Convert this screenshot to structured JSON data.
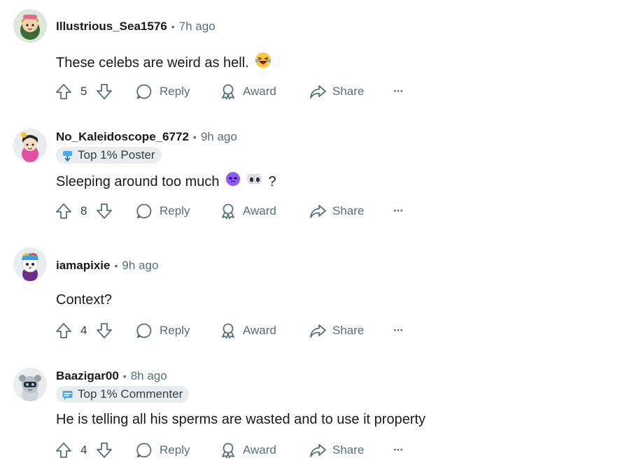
{
  "comments": [
    {
      "username": "Illustrious_Sea1576",
      "time": "7h ago",
      "flair": null,
      "text": "These celebs are weird as hell.",
      "emojis": [
        "laughing-face"
      ],
      "votes": "5"
    },
    {
      "username": "No_Kaleidoscope_6772",
      "time": "9h ago",
      "flair": "Top 1% Poster",
      "text": "Sleeping around too much",
      "emojis": [
        "pleading-purple-face",
        "eyes"
      ],
      "trailing": "?",
      "votes": "8"
    },
    {
      "username": "iamapixie",
      "time": "9h ago",
      "flair": null,
      "text": "Context?",
      "emojis": [],
      "votes": "4"
    },
    {
      "username": "Baazigar00",
      "time": "8h ago",
      "flair": "Top 1% Commenter",
      "text": "He is telling all his sperms are wasted and to use it property",
      "emojis": [],
      "votes": "4"
    }
  ],
  "actions": {
    "reply": "Reply",
    "award": "Award",
    "share": "Share",
    "more": "···"
  },
  "separator": "•",
  "colors": {
    "meta_gray": "#576f76",
    "flair_bg": "#eaedef",
    "text": "#1a1a1b"
  }
}
